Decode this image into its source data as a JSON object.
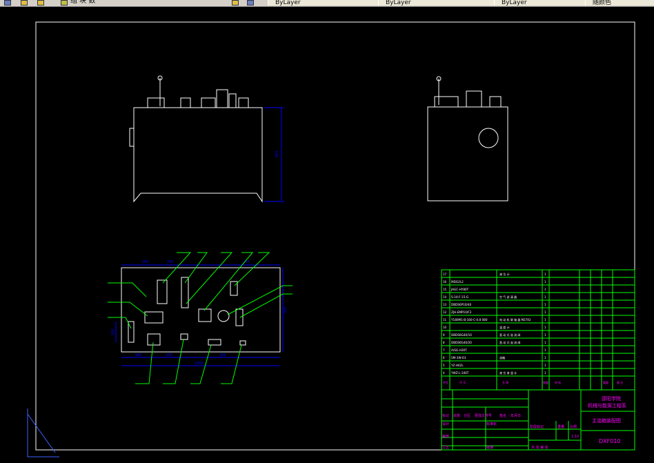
{
  "toolbar": {
    "label_left": "组 块 数",
    "tab1": "ByLayer",
    "tab2": "ByLayer",
    "tab3": "ByLayer",
    "tab4": "随颜色"
  },
  "drawing": {
    "front_view": {
      "height_dim": "960"
    },
    "plan_view": {
      "dims_top": [
        "260",
        "200",
        "200"
      ],
      "dims_bottom": [
        "960",
        "200",
        "200",
        "1560"
      ],
      "dim_right": "920",
      "dim_left": "160",
      "balloons": [
        "1",
        "2",
        "3",
        "4",
        "5",
        "6",
        "7",
        "8",
        "9",
        "10",
        "11",
        "12",
        "13",
        "14",
        "15",
        "16",
        "17"
      ]
    },
    "bom": {
      "rows": [
        {
          "no": "17",
          "code": "",
          "name": "液 位 计",
          "qty": "1"
        },
        {
          "no": "16",
          "code": "MDG2L2",
          "name": "",
          "qty": "1"
        },
        {
          "no": "15",
          "code": "JAGC-HY80T",
          "name": "",
          "qty": "1"
        },
        {
          "no": "14",
          "code": "S-10-F-15-G",
          "name": "空 气 滤 清 器",
          "qty": "1"
        },
        {
          "no": "13",
          "code": "DBDS6P10/40",
          "name": "",
          "qty": "1"
        },
        {
          "no": "12",
          "code": "ZJH-EMP10/F2",
          "name": "",
          "qty": "1"
        },
        {
          "no": "11",
          "code": "Y180M1-B-160-C-0.8 080",
          "name": "电 动 机 联 轴 器 M27X2",
          "qty": "1"
        },
        {
          "no": "10",
          "code": "",
          "name": "温 度 计",
          "qty": "1"
        },
        {
          "no": "9",
          "code": "DBDS6G40/10",
          "name": "直 动 式 溢 流 阀",
          "qty": "1"
        },
        {
          "no": "8",
          "code": "DBDS6G40/20",
          "name": "直 动 式 溢 流 阀",
          "qty": "1"
        },
        {
          "no": "7",
          "code": "A/SG-H30T",
          "name": "",
          "qty": "1"
        },
        {
          "no": "6",
          "code": "SM-3W-03",
          "name": "油箱",
          "qty": "1"
        },
        {
          "no": "5",
          "code": "YZ-H02L",
          "name": "",
          "qty": "1"
        },
        {
          "no": "4",
          "code": "YWZ-L-100T",
          "name": "液 位 液 温 计",
          "qty": "1"
        }
      ],
      "header": {
        "no": "序号",
        "code": "代 号",
        "name": "名 称",
        "qty": "数量",
        "material": "材 料",
        "weight": "重量",
        "remark": "备 注"
      }
    },
    "title_block": {
      "school": "邵阳学院",
      "dept": "机械与能源工程系",
      "drawing_name": "主油箱装配图",
      "drawing_no": "DXF010",
      "scale": "1:10",
      "labels": {
        "mark": "标记",
        "count": "处数",
        "zone": "分区",
        "change": "更改文件号",
        "sign": "签名",
        "date": "年月日",
        "design": "设计",
        "standard": "标准化",
        "review": "审核",
        "process": "工艺",
        "approve": "批准",
        "stage": "阶段标记",
        "weight": "重量",
        "ratio": "比例",
        "sheet": "共 张 第 张"
      }
    },
    "colors": {
      "frame": "#ffffff",
      "dim": "#0000ff",
      "leader": "#00ff00",
      "text": "#ff00ff",
      "green": "#00ff00"
    }
  }
}
